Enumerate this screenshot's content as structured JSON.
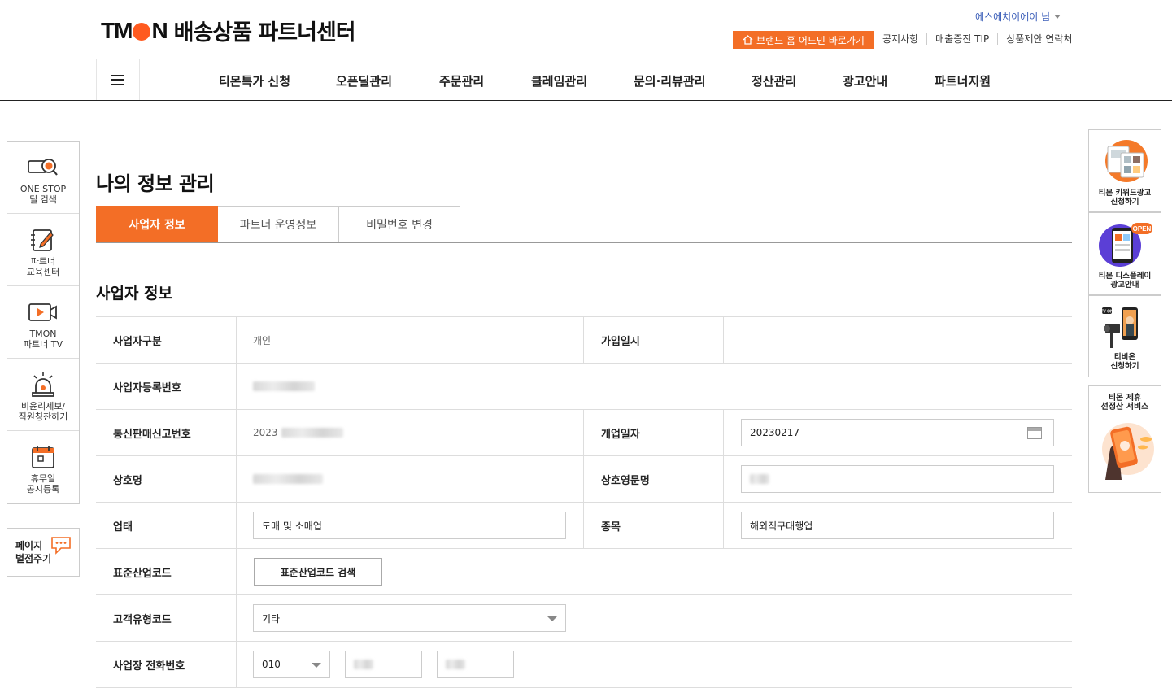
{
  "header": {
    "logo_text_pre": "TM",
    "logo_text_post": "N",
    "site_title": "배송상품 파트너센터",
    "user_name": "에스에치이에이 님",
    "brand_button": "브랜드 홈 어드민 바로가기",
    "links": [
      "공지사항",
      "매출증진 TIP",
      "상품제안 연락처"
    ]
  },
  "gnb": {
    "items": [
      "티몬특가 신청",
      "오픈딜관리",
      "주문관리",
      "클레임관리",
      "문의·리뷰관리",
      "정산관리",
      "광고안내",
      "파트너지원"
    ]
  },
  "left_quick": {
    "items": [
      {
        "label": "ONE STOP\n딜 검색",
        "icon": "magnifier-search-icon"
      },
      {
        "label": "파트너\n교육센터",
        "icon": "notebook-edit-icon"
      },
      {
        "label": "TMON\n파트너 TV",
        "icon": "video-camera-icon"
      },
      {
        "label": "비윤리제보/\n직원칭찬하기",
        "icon": "siren-alarm-icon"
      },
      {
        "label": "휴무일\n공지등록",
        "icon": "calendar-icon"
      }
    ],
    "rate_label": "페이지\n별점주기",
    "rate_icon": "chat-bubble-icon"
  },
  "right_banners": [
    {
      "label": "티몬 키워드광고\n신청하기"
    },
    {
      "label": "티몬 디스플레이\n광고안내",
      "badge": "OPEN"
    },
    {
      "label": "티비온\n신청하기",
      "badge": "TV ON"
    },
    {
      "label": "티몬 제휴\n선정산 서비스"
    }
  ],
  "main": {
    "page_title": "나의 정보 관리",
    "tabs": [
      "사업자 정보",
      "파트너 운영정보",
      "비밀번호 변경"
    ],
    "section_title": "사업자 정보",
    "fields": {
      "biz_type_label": "사업자구분",
      "biz_type_value": "개인",
      "join_date_label": "가입일시",
      "reg_no_label": "사업자등록번호",
      "ecom_no_label": "통신판매신고번호",
      "ecom_no_prefix": "2023-",
      "open_date_label": "개업일자",
      "open_date_value": "20230217",
      "company_name_label": "상호명",
      "company_en_label": "상호영문명",
      "business_label": "업태",
      "business_value": "도매 및 소매업",
      "item_label": "종목",
      "item_value": "해외직구대행업",
      "industry_code_label": "표준산업코드",
      "industry_code_button": "표준산업코드 검색",
      "customer_type_label": "고객유형코드",
      "customer_type_value": "기타",
      "phone_label": "사업장 전화번호",
      "phone_prefix": "010",
      "phone_dash": "–"
    }
  },
  "colors": {
    "accent": "#f36e26",
    "link_blue": "#3a5db8"
  }
}
